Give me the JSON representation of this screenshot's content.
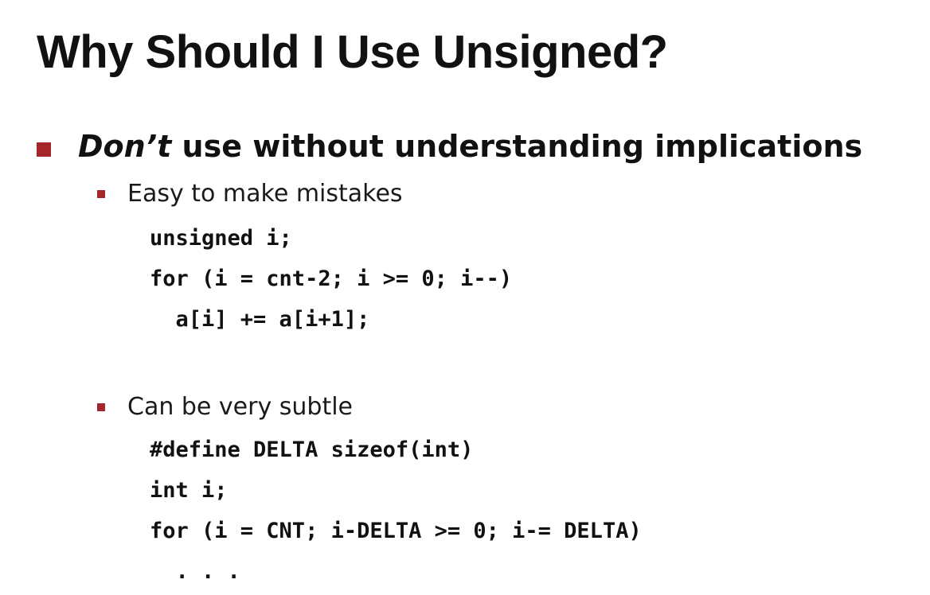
{
  "slide": {
    "title": "Why Should I Use Unsigned?",
    "bullet": {
      "italic_part": "Don’t",
      "rest": " use without understanding implications"
    },
    "sub1": {
      "label": "Easy to make mistakes",
      "code": [
        "unsigned i;",
        "for (i = cnt-2; i >= 0; i--)",
        "  a[i] += a[i+1];"
      ]
    },
    "sub2": {
      "label": "Can be very subtle",
      "code": [
        "#define DELTA sizeof(int)",
        "int i;",
        "for (i = CNT; i-DELTA >= 0; i-= DELTA)",
        "  . . ."
      ]
    }
  },
  "colors": {
    "bullet_accent": "#a6272b"
  }
}
